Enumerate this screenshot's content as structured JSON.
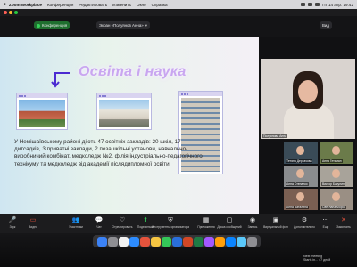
{
  "menubar": {
    "items": [
      "Zoom Workplace",
      "Конференция",
      "Редактировать",
      "Изменить",
      "Окно",
      "Справка"
    ],
    "time": "Пт 14 апр. 19:42"
  },
  "toolbar": {
    "conference_label": "Конференция",
    "view_label": "Экран «Полуянов Анна»",
    "view_option": "Вид"
  },
  "slide": {
    "title": "Освіта і наука",
    "text": "У Немішаївському районі діють 47 освітніх закладів: 20 шкіл, 17 дитсадків, 3 приватні заклади, 2 позашкільні установи, навчально-виробничий комбінат, медколедж №2, філія індустріально-педагогічного технікуму та медколедж від академії післядипломної освіти."
  },
  "participants": [
    {
      "name": "Полуянова Анна"
    },
    {
      "name": "Тетяна Деркачова"
    },
    {
      "name": "Анна Гетьман"
    },
    {
      "name": "Анна Степанко"
    },
    {
      "name": "Виктор Бакулин"
    },
    {
      "name": "Анна Ваталина"
    },
    {
      "name": "Светлана Мороз"
    }
  ],
  "controls": [
    {
      "label": "Звук",
      "icon": "microphone-icon"
    },
    {
      "label": "Видео",
      "icon": "video-icon"
    },
    {
      "label": "Участники",
      "icon": "participants-icon"
    },
    {
      "label": "Чат",
      "icon": "chat-icon"
    },
    {
      "label": "Отреагировать",
      "icon": "heart-icon"
    },
    {
      "label": "Поделиться",
      "icon": "share-icon"
    },
    {
      "label": "Инструменты организатора",
      "icon": "shield-icon"
    },
    {
      "label": "Приложения",
      "icon": "apps-icon"
    },
    {
      "label": "Доска сообщений",
      "icon": "whiteboard-icon"
    },
    {
      "label": "Запись",
      "icon": "record-icon"
    },
    {
      "label": "Еще",
      "icon": "more-icon"
    },
    {
      "label": "Закончить",
      "icon": "leave-icon"
    }
  ],
  "right_controls": [
    {
      "label": "Виртуальный фон",
      "icon": "background-icon"
    },
    {
      "label": "Дополнительно",
      "icon": "extras-icon"
    }
  ],
  "notification": {
    "line1": "Next meeting",
    "line2": "Starts in... 47 дней"
  },
  "colors": {
    "zoom_green": "#34c759",
    "slide_title": "#c9a6f0",
    "end_red": "#e5533d"
  }
}
